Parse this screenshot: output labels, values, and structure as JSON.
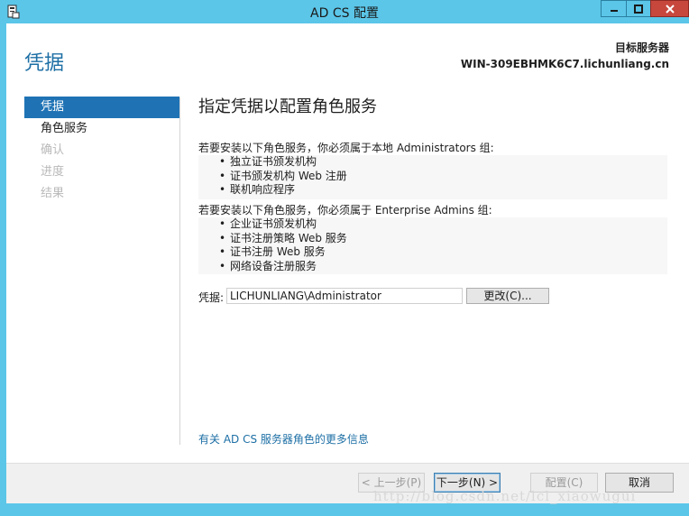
{
  "window": {
    "title": "AD CS 配置",
    "icons": {
      "app": "server-manager-icon",
      "minimize": "minimize-icon",
      "maximize": "maximize-icon",
      "close": "close-icon"
    },
    "colors": {
      "titlebar": "#5bc6e8",
      "close": "#c7473d",
      "accent": "#1f73b5"
    }
  },
  "header": {
    "page_title": "凭据",
    "target_label": "目标服务器",
    "target_value": "WIN-309EBHMK6C7.lichunliang.cn"
  },
  "nav": {
    "items": [
      {
        "label": "凭据",
        "state": "active"
      },
      {
        "label": "角色服务",
        "state": "enabled"
      },
      {
        "label": "确认",
        "state": "disabled"
      },
      {
        "label": "进度",
        "state": "disabled"
      },
      {
        "label": "结果",
        "state": "disabled"
      }
    ]
  },
  "main": {
    "heading": "指定凭据以配置角色服务",
    "local_admins_text": "若要安装以下角色服务，你必须属于本地 Administrators 组:",
    "local_admins_list": [
      "独立证书颁发机构",
      "证书颁发机构 Web 注册",
      "联机响应程序"
    ],
    "enterprise_admins_text": "若要安装以下角色服务，你必须属于 Enterprise Admins 组:",
    "enterprise_admins_list": [
      "企业证书颁发机构",
      "证书注册策略 Web 服务",
      "证书注册 Web 服务",
      "网络设备注册服务"
    ],
    "bullet": "•",
    "credential_label": "凭据:",
    "credential_value": "LICHUNLIANG\\Administrator",
    "change_button": "更改(C)...",
    "more_info_link": "有关 AD CS 服务器角色的更多信息"
  },
  "footer": {
    "prev_button": "< 上一步(P)",
    "next_button": "下一步(N) >",
    "configure_button": "配置(C)",
    "cancel_button": "取消"
  },
  "watermark": "http://blog.csdn.net/lcl_xiaowugui"
}
